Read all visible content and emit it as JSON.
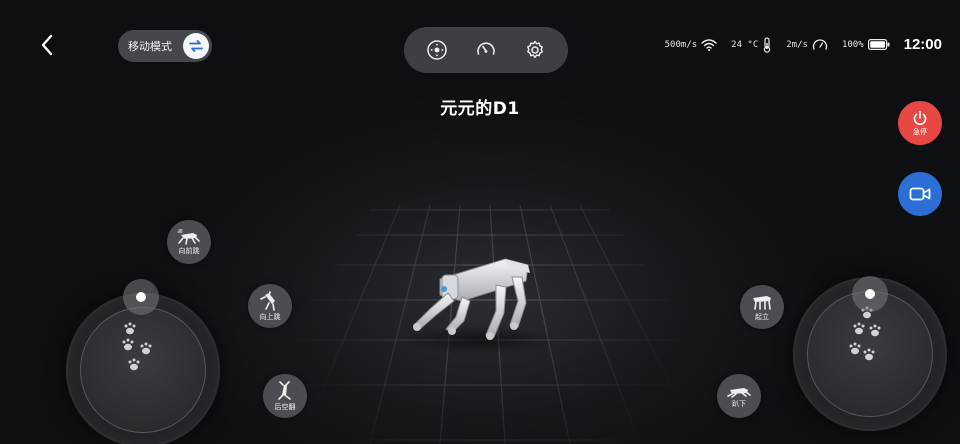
{
  "app": {
    "title": "元元的D1",
    "mode_label": "移动模式"
  },
  "status": {
    "speed_net": "500m/s",
    "temperature": "24 °C",
    "speed_move": "2m/s",
    "battery": "100%",
    "battery_level": 1.0,
    "time": "12:00"
  },
  "topbar": {
    "icons": [
      "joystick-icon",
      "speedometer-icon",
      "settings-gear-icon"
    ]
  },
  "right_buttons": {
    "estop_label": "急停"
  },
  "actions": {
    "jump_forward": "向前跳",
    "jump_up": "向上跳",
    "backflip": "后空翻",
    "stand_up": "起立",
    "lie_down": "趴下"
  },
  "colors": {
    "estop": "#e84844",
    "camera": "#2b6fd6",
    "panel": "#3d3f44",
    "background": "#0e0f12"
  }
}
